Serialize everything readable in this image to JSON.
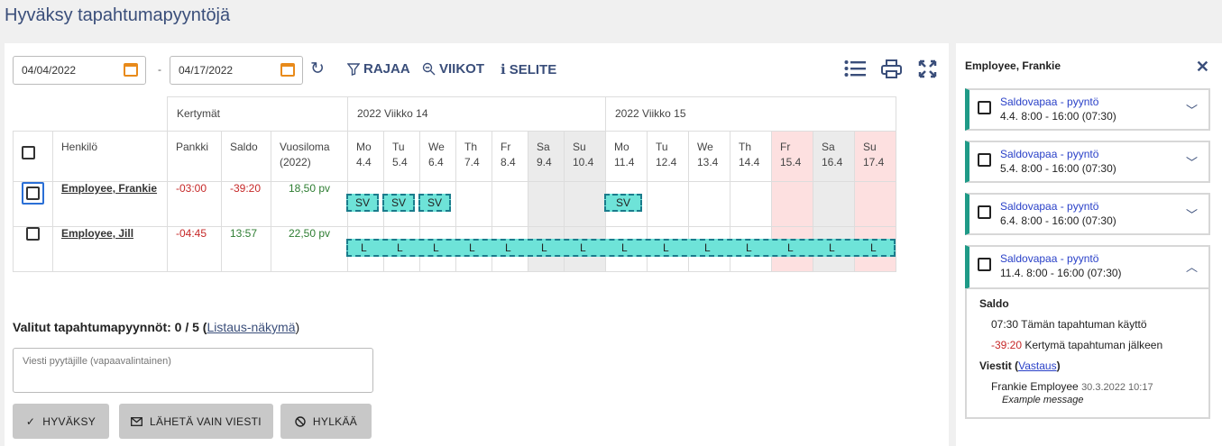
{
  "page_title": "Hyväksy tapahtumapyyntöjä",
  "filters": {
    "start_date": "04/04/2022",
    "end_date": "04/17/2022",
    "separator": "-",
    "rajaa": "RAJAA",
    "viikot": "VIIKOT",
    "selite": "SELITE"
  },
  "table": {
    "kertymat": "Kertymät",
    "week14": "2022 Viikko 14",
    "week15": "2022 Viikko 15",
    "col_person": "Henkilö",
    "col_pankki": "Pankki",
    "col_saldo": "Saldo",
    "col_vuosiloma_1": "Vuosiloma",
    "col_vuosiloma_2": "(2022)",
    "days": [
      {
        "d": "Mo",
        "n": "4.4"
      },
      {
        "d": "Tu",
        "n": "5.4"
      },
      {
        "d": "We",
        "n": "6.4"
      },
      {
        "d": "Th",
        "n": "7.4"
      },
      {
        "d": "Fr",
        "n": "8.4"
      },
      {
        "d": "Sa",
        "n": "9.4"
      },
      {
        "d": "Su",
        "n": "10.4"
      },
      {
        "d": "Mo",
        "n": "11.4"
      },
      {
        "d": "Tu",
        "n": "12.4"
      },
      {
        "d": "We",
        "n": "13.4"
      },
      {
        "d": "Th",
        "n": "14.4"
      },
      {
        "d": "Fr",
        "n": "15.4"
      },
      {
        "d": "Sa",
        "n": "16.4"
      },
      {
        "d": "Su",
        "n": "17.4"
      }
    ],
    "rows": [
      {
        "name": "Employee, Frankie",
        "pankki": "-03:00",
        "saldo": "-39:20",
        "vuosiloma": "18,50 pv"
      },
      {
        "name": "Employee, Jill",
        "pankki": "-04:45",
        "saldo": "13:57",
        "vuosiloma": "22,50 pv"
      }
    ],
    "frankie_chip": "SV",
    "jill_chip": "L"
  },
  "selected": {
    "label": "Valitut tapahtumapyynnöt: 0 / 5 (",
    "link": "Listaus-näkymä",
    "close": ")"
  },
  "message_placeholder": "Viesti pyytäjille (vapaavalintainen)",
  "actions": {
    "approve": "HYVÄKSY",
    "send_message": "LÄHETÄ VAIN VIESTI",
    "reject": "HYLKÄÄ"
  },
  "sidebar": {
    "employee": "Employee, Frankie",
    "requests": [
      {
        "title": "Saldovapaa - pyyntö",
        "time": "4.4. 8:00 - 16:00 (07:30)"
      },
      {
        "title": "Saldovapaa - pyyntö",
        "time": "5.4. 8:00 - 16:00 (07:30)"
      },
      {
        "title": "Saldovapaa - pyyntö",
        "time": "6.4. 8:00 - 16:00 (07:30)"
      },
      {
        "title": "Saldovapaa - pyyntö",
        "time": "11.4. 8:00 - 16:00 (07:30)"
      }
    ],
    "detail": {
      "saldo_heading": "Saldo",
      "usage_value": "07:30",
      "usage_label": "Tämän tapahtuman käyttö",
      "after_value": "-39:20",
      "after_label": "Kertymä tapahtuman jälkeen",
      "messages_heading": "Viestit (",
      "reply_link": "Vastaus",
      "messages_close": ")",
      "author": "Frankie Employee",
      "timestamp": "30.3.2022 10:17",
      "message": "Example message"
    }
  }
}
